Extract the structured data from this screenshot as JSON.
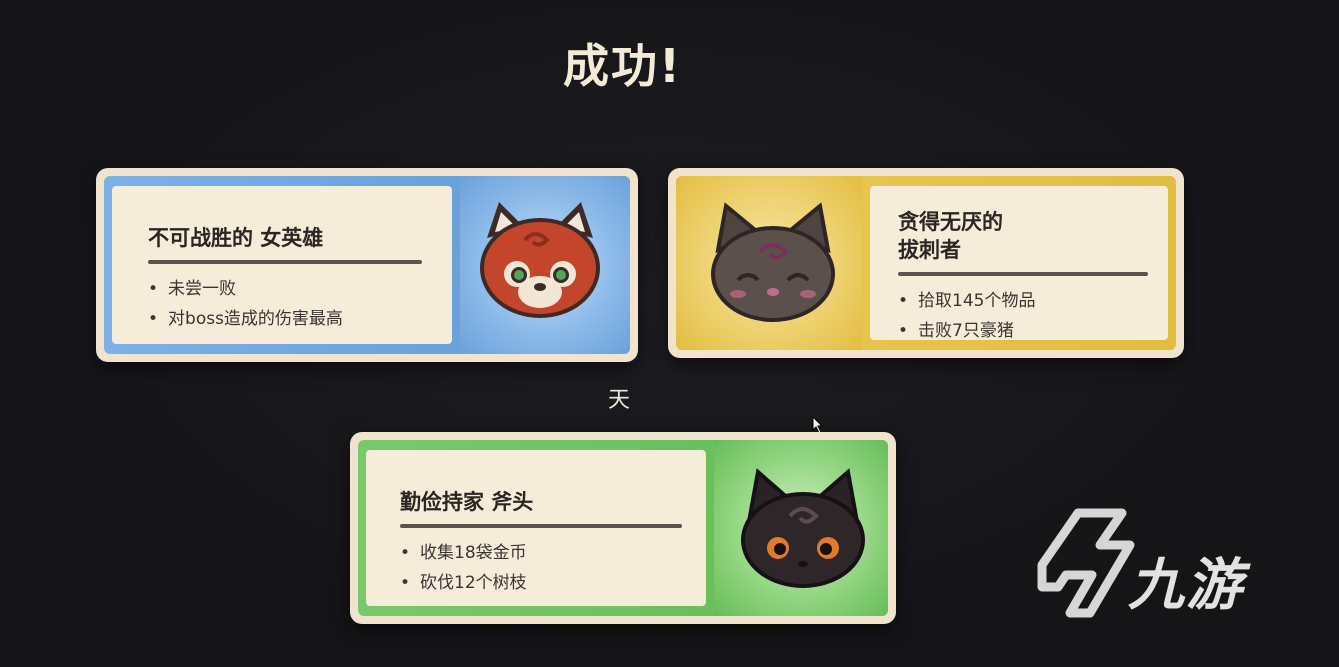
{
  "title": "成功!",
  "day_label": "天",
  "cards": [
    {
      "title": "不可战胜的 女英雄",
      "bullets": [
        "未尝一败",
        "对boss造成的伤害最高"
      ],
      "accent": "#6fa6dd",
      "portrait": "red-panda-icon"
    },
    {
      "title_line1": "贪得无厌的",
      "title_line2": "拔刺者",
      "bullets": [
        "拾取145个物品",
        "击败7只豪猪"
      ],
      "accent": "#e6c24a",
      "portrait": "gray-cat-icon"
    },
    {
      "title": "勤俭持家 斧头",
      "bullets": [
        "收集18袋金币",
        "砍伐12个树枝"
      ],
      "accent": "#6cc25b",
      "portrait": "black-cat-icon"
    }
  ],
  "watermark": {
    "text": "九游",
    "icon": "jiuyou-logo-icon"
  }
}
